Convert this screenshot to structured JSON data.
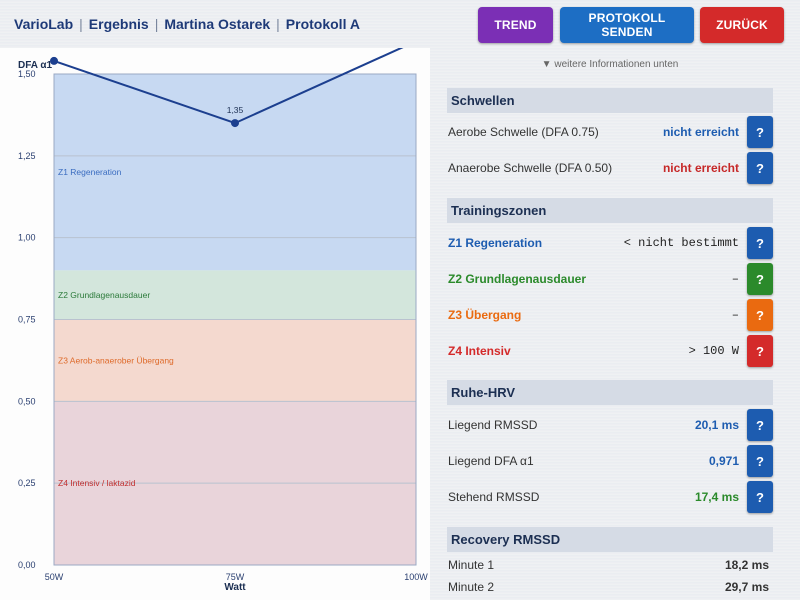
{
  "header": {
    "crumbs": [
      "VarioLab",
      "Ergebnis",
      "Martina Ostarek",
      "Protokoll A"
    ],
    "separator": "|",
    "buttons": {
      "trend": "TREND",
      "send": "PROTOKOLL SENDEN",
      "back": "ZURÜCK"
    }
  },
  "chart_data": {
    "type": "line",
    "ylabel": "DFA α1",
    "xlabel": "Watt",
    "x_ticks": [
      "50W",
      "75W",
      "100W"
    ],
    "y_ticks": [
      "0,00",
      "0,25",
      "0,50",
      "0,75",
      "1,00",
      "1,25",
      "1,50"
    ],
    "ylim": [
      0,
      1.5
    ],
    "xlim": [
      50,
      100
    ],
    "points": [
      {
        "x": 50,
        "y": 1.54
      },
      {
        "x": 75,
        "y": 1.35,
        "label": "1,35"
      },
      {
        "x": 100,
        "y": 1.6
      }
    ],
    "zones": [
      {
        "name": "Z1  Regeneration",
        "from": 0.9,
        "to": 1.5,
        "fill": "#c7d9f2",
        "text_color": "#3a6cc0"
      },
      {
        "name": "Z2  Grundlagenausdauer",
        "from": 0.75,
        "to": 0.9,
        "fill": "#d3e6dc",
        "text_color": "#2b7a3a"
      },
      {
        "name": "Z3  Aerob-anaerober Übergang",
        "from": 0.5,
        "to": 0.75,
        "fill": "#f4d9cf",
        "text_color": "#de6a2a"
      },
      {
        "name": "Z4  Intensiv / laktazid",
        "from": 0.0,
        "to": 0.5,
        "fill": "#e9d4da",
        "text_color": "#c23030"
      }
    ],
    "line_color": "#1c3f8f",
    "grid": true
  },
  "info_hint": "▼ weitere Informationen unten",
  "schwellen": {
    "title": "Schwellen",
    "rows": [
      {
        "label": "Aerobe Schwelle (DFA 0.75)",
        "value": "nicht erreicht",
        "color": "#1d5cb0"
      },
      {
        "label": "Anaerobe Schwelle (DFA 0.50)",
        "value": "nicht erreicht",
        "color": "#c62828"
      }
    ]
  },
  "zonen": {
    "title": "Trainingszonen",
    "rows": [
      {
        "label": "Z1 Regeneration",
        "value": "< nicht bestimmt",
        "color": "#1d5cb0"
      },
      {
        "label": "Z2 Grundlagenausdauer",
        "value": "–",
        "color": "#2b8a2b"
      },
      {
        "label": "Z3 Übergang",
        "value": "–",
        "color": "#ea6a10"
      },
      {
        "label": "Z4 Intensiv",
        "value": "> 100 W",
        "color": "#d42a2a"
      }
    ]
  },
  "ruhe": {
    "title": "Ruhe-HRV",
    "rows": [
      {
        "label": "Liegend RMSSD",
        "value": "20,1 ms",
        "color": "#1d5cb0"
      },
      {
        "label": "Liegend DFA α1",
        "value": "0,971",
        "color": "#1d5cb0"
      },
      {
        "label": "Stehend RMSSD",
        "value": "17,4 ms",
        "color": "#2b8a2b"
      }
    ]
  },
  "recovery": {
    "title": "Recovery RMSSD",
    "rows": [
      {
        "label": "Minute 1",
        "value": "18,2 ms"
      },
      {
        "label": "Minute 2",
        "value": "29,7 ms"
      }
    ]
  },
  "help_label": "?"
}
